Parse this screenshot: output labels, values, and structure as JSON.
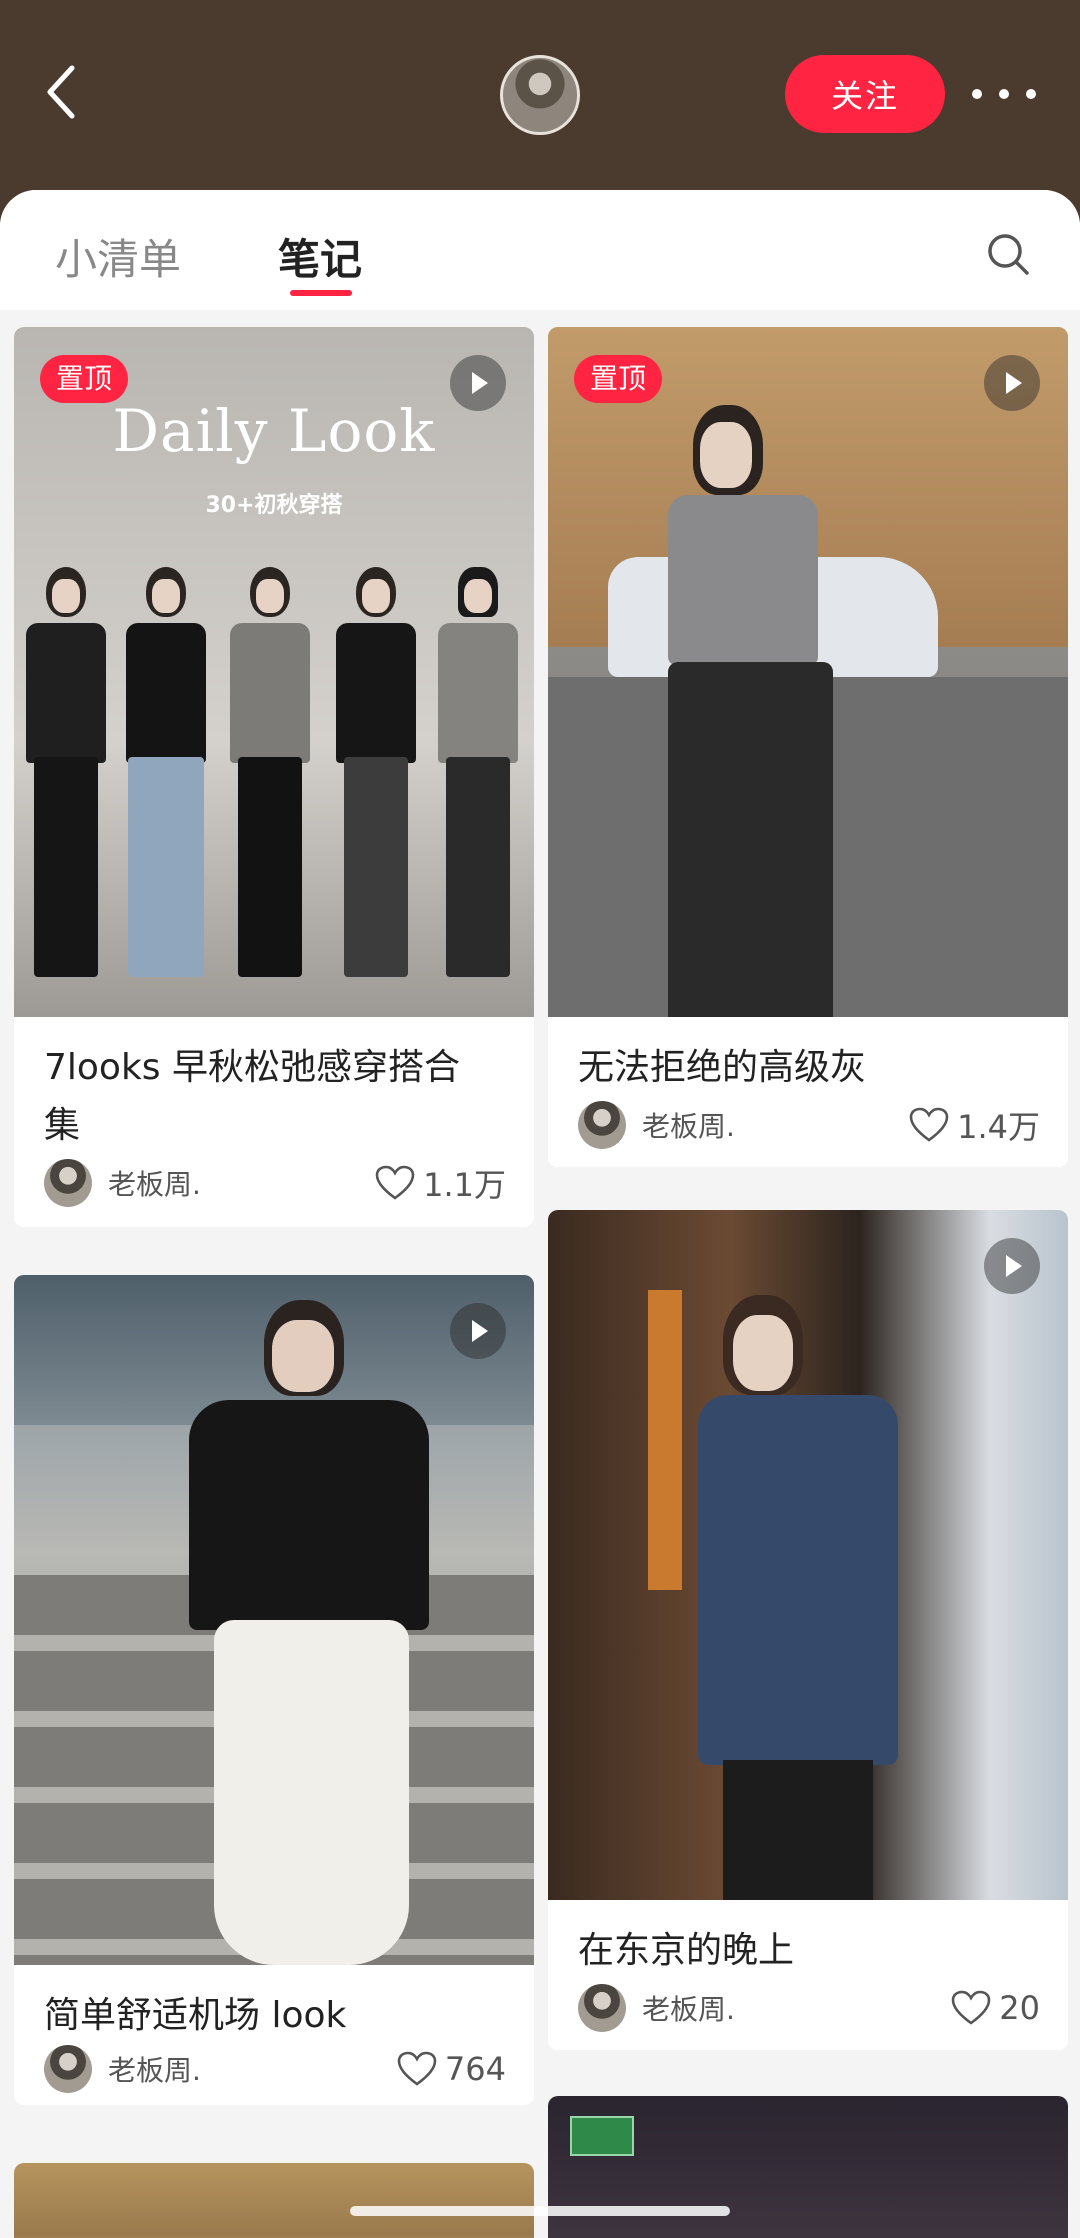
{
  "header": {
    "follow_label": "关注"
  },
  "tabs": [
    {
      "label": "小清单",
      "active": false
    },
    {
      "label": "笔记",
      "active": true
    }
  ],
  "cover_daily": {
    "title": "Daily Look",
    "subtitle": "30+初秋穿搭"
  },
  "pin_label": "置顶",
  "notes": [
    {
      "title_line1": "7looks 早秋松弛感穿搭合",
      "title_line2": "集",
      "author": "老板周.",
      "likes": "1.1万",
      "pinned": true,
      "video": true
    },
    {
      "title_line1": "无法拒绝的高级灰",
      "author": "老板周.",
      "likes": "1.4万",
      "pinned": true,
      "video": true
    },
    {
      "title_line1": "简单舒适机场 look",
      "author": "老板周.",
      "likes": "764",
      "pinned": false,
      "video": true
    },
    {
      "title_line1": "在东京的晚上",
      "author": "老板周.",
      "likes": "20",
      "pinned": false,
      "video": true
    }
  ],
  "colors": {
    "header_bg": "#4a3b2e",
    "accent": "#ff2442",
    "panel_bg": "#f4f4f4"
  }
}
